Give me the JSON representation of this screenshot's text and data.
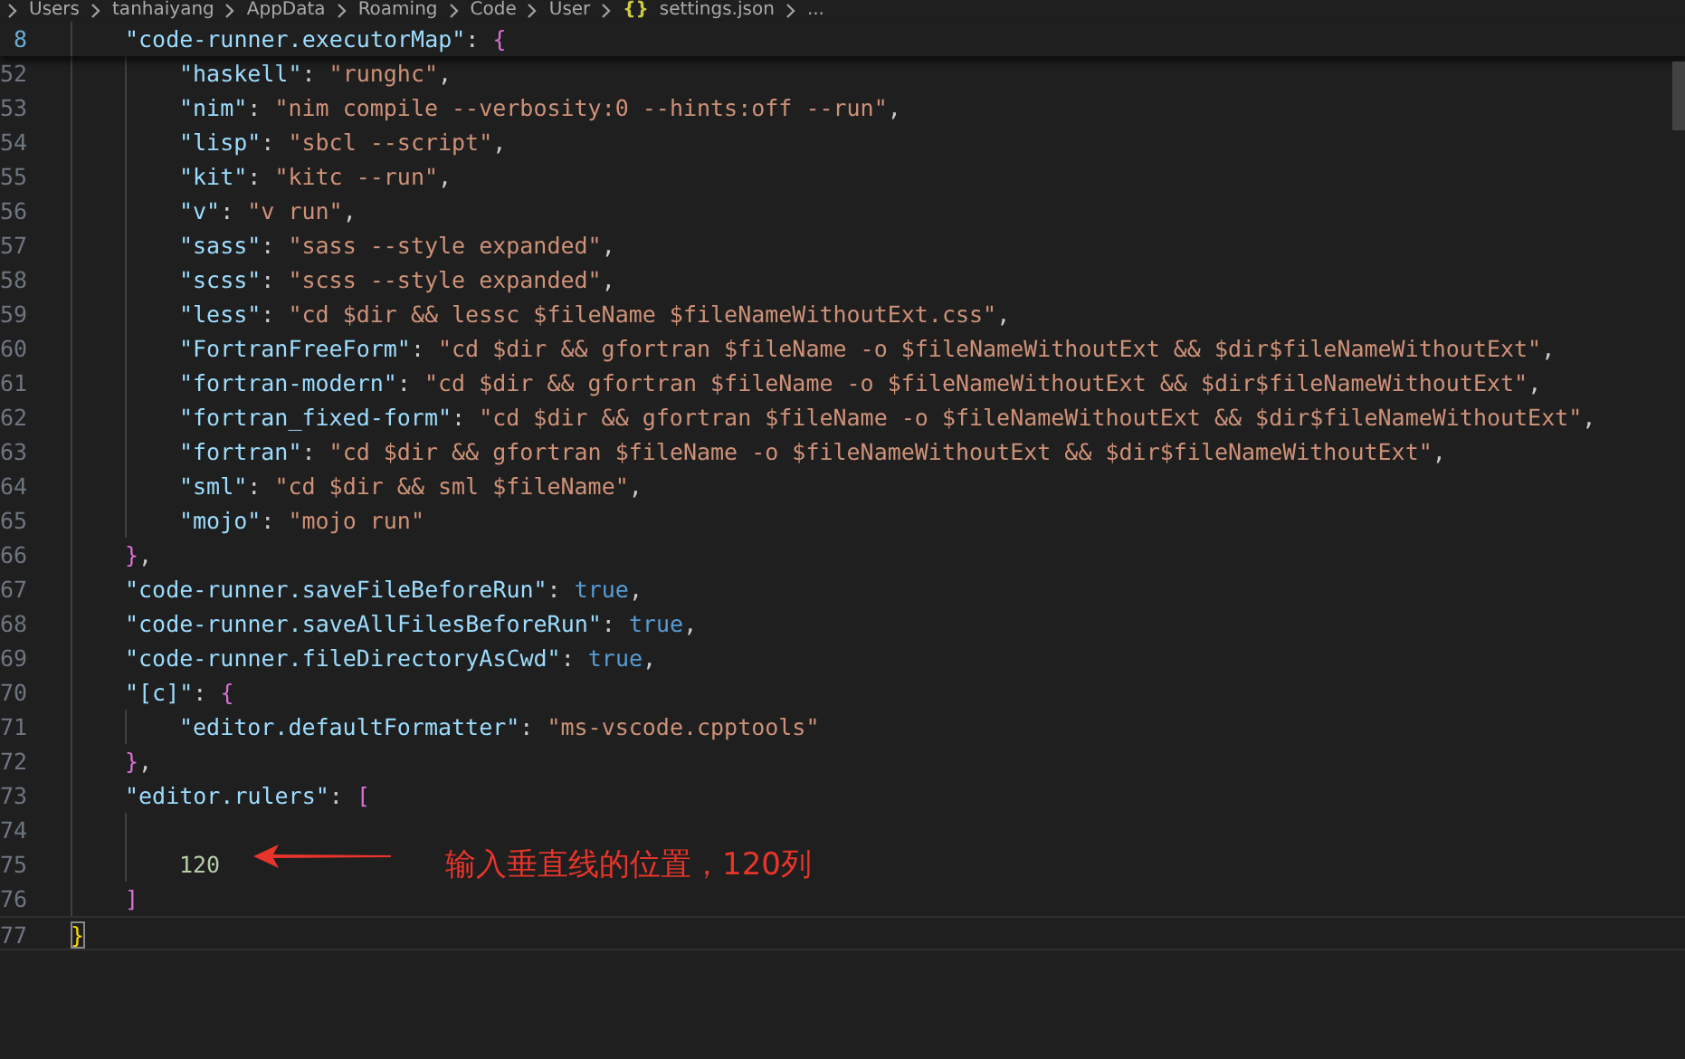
{
  "breadcrumb": [
    {
      "kind": "folder",
      "label": "Users"
    },
    {
      "kind": "folder",
      "label": "tanhaiyang"
    },
    {
      "kind": "folder",
      "label": "AppData"
    },
    {
      "kind": "folder",
      "label": "Roaming"
    },
    {
      "kind": "folder",
      "label": "Code"
    },
    {
      "kind": "folder",
      "label": "User"
    },
    {
      "kind": "file",
      "glyph": "{}",
      "label": "settings.json"
    },
    {
      "kind": "more",
      "label": "..."
    }
  ],
  "sticky_line": {
    "number": "8",
    "tokens": [
      {
        "kind": "key",
        "text": "\"code-runner.executorMap\""
      },
      {
        "kind": "punct",
        "text": ": "
      },
      {
        "kind": "bracket-inner",
        "text": "{"
      }
    ],
    "children": [
      {
        "number": "52",
        "tokens": [
          {
            "kind": "key",
            "text": "\"haskell\""
          },
          {
            "kind": "punct",
            "text": ": "
          },
          {
            "kind": "string",
            "text": "\"runghc\""
          },
          {
            "kind": "punct",
            "text": ","
          }
        ]
      },
      {
        "number": "53",
        "tokens": [
          {
            "kind": "key",
            "text": "\"nim\""
          },
          {
            "kind": "punct",
            "text": ": "
          },
          {
            "kind": "string",
            "text": "\"nim compile --verbosity:0 --hints:off --run\""
          },
          {
            "kind": "punct",
            "text": ","
          }
        ]
      },
      {
        "number": "54",
        "tokens": [
          {
            "kind": "key",
            "text": "\"lisp\""
          },
          {
            "kind": "punct",
            "text": ": "
          },
          {
            "kind": "string",
            "text": "\"sbcl --script\""
          },
          {
            "kind": "punct",
            "text": ","
          }
        ]
      },
      {
        "number": "55",
        "tokens": [
          {
            "kind": "key",
            "text": "\"kit\""
          },
          {
            "kind": "punct",
            "text": ": "
          },
          {
            "kind": "string",
            "text": "\"kitc --run\""
          },
          {
            "kind": "punct",
            "text": ","
          }
        ]
      },
      {
        "number": "56",
        "tokens": [
          {
            "kind": "key",
            "text": "\"v\""
          },
          {
            "kind": "punct",
            "text": ": "
          },
          {
            "kind": "string",
            "text": "\"v run\""
          },
          {
            "kind": "punct",
            "text": ","
          }
        ]
      },
      {
        "number": "57",
        "tokens": [
          {
            "kind": "key",
            "text": "\"sass\""
          },
          {
            "kind": "punct",
            "text": ": "
          },
          {
            "kind": "string",
            "text": "\"sass --style expanded\""
          },
          {
            "kind": "punct",
            "text": ","
          }
        ]
      },
      {
        "number": "58",
        "tokens": [
          {
            "kind": "key",
            "text": "\"scss\""
          },
          {
            "kind": "punct",
            "text": ": "
          },
          {
            "kind": "string",
            "text": "\"scss --style expanded\""
          },
          {
            "kind": "punct",
            "text": ","
          }
        ]
      },
      {
        "number": "59",
        "tokens": [
          {
            "kind": "key",
            "text": "\"less\""
          },
          {
            "kind": "punct",
            "text": ": "
          },
          {
            "kind": "string",
            "text": "\"cd $dir && lessc $fileName $fileNameWithoutExt.css\""
          },
          {
            "kind": "punct",
            "text": ","
          }
        ]
      },
      {
        "number": "60",
        "tokens": [
          {
            "kind": "key",
            "text": "\"FortranFreeForm\""
          },
          {
            "kind": "punct",
            "text": ": "
          },
          {
            "kind": "string",
            "text": "\"cd $dir && gfortran $fileName -o $fileNameWithoutExt && $dir$fileNameWithoutExt\""
          },
          {
            "kind": "punct",
            "text": ","
          }
        ]
      },
      {
        "number": "61",
        "tokens": [
          {
            "kind": "key",
            "text": "\"fortran-modern\""
          },
          {
            "kind": "punct",
            "text": ": "
          },
          {
            "kind": "string",
            "text": "\"cd $dir && gfortran $fileName -o $fileNameWithoutExt && $dir$fileNameWithoutExt\""
          },
          {
            "kind": "punct",
            "text": ","
          }
        ]
      },
      {
        "number": "62",
        "tokens": [
          {
            "kind": "key",
            "text": "\"fortran_fixed-form\""
          },
          {
            "kind": "punct",
            "text": ": "
          },
          {
            "kind": "string",
            "text": "\"cd $dir && gfortran $fileName -o $fileNameWithoutExt && $dir$fileNameWithoutExt\""
          },
          {
            "kind": "punct",
            "text": ","
          }
        ]
      },
      {
        "number": "63",
        "tokens": [
          {
            "kind": "key",
            "text": "\"fortran\""
          },
          {
            "kind": "punct",
            "text": ": "
          },
          {
            "kind": "string",
            "text": "\"cd $dir && gfortran $fileName -o $fileNameWithoutExt && $dir$fileNameWithoutExt\""
          },
          {
            "kind": "punct",
            "text": ","
          }
        ]
      },
      {
        "number": "64",
        "tokens": [
          {
            "kind": "key",
            "text": "\"sml\""
          },
          {
            "kind": "punct",
            "text": ": "
          },
          {
            "kind": "string",
            "text": "\"cd $dir && sml $fileName\""
          },
          {
            "kind": "punct",
            "text": ","
          }
        ]
      },
      {
        "number": "65",
        "tokens": [
          {
            "kind": "key",
            "text": "\"mojo\""
          },
          {
            "kind": "punct",
            "text": ": "
          },
          {
            "kind": "string",
            "text": "\"mojo run\""
          }
        ]
      }
    ]
  },
  "lines": [
    {
      "number": "66",
      "tokens": [
        {
          "kind": "bracket-inner",
          "text": "}"
        },
        {
          "kind": "punct",
          "text": ","
        }
      ]
    },
    {
      "number": "67",
      "tokens": [
        {
          "kind": "key",
          "text": "\"code-runner.saveFileBeforeRun\""
        },
        {
          "kind": "punct",
          "text": ": "
        },
        {
          "kind": "bool",
          "text": "true"
        },
        {
          "kind": "punct",
          "text": ","
        }
      ]
    },
    {
      "number": "68",
      "tokens": [
        {
          "kind": "key",
          "text": "\"code-runner.saveAllFilesBeforeRun\""
        },
        {
          "kind": "punct",
          "text": ": "
        },
        {
          "kind": "bool",
          "text": "true"
        },
        {
          "kind": "punct",
          "text": ","
        }
      ]
    },
    {
      "number": "69",
      "tokens": [
        {
          "kind": "key",
          "text": "\"code-runner.fileDirectoryAsCwd\""
        },
        {
          "kind": "punct",
          "text": ": "
        },
        {
          "kind": "bool",
          "text": "true"
        },
        {
          "kind": "punct",
          "text": ","
        }
      ]
    },
    {
      "number": "70",
      "tokens": [
        {
          "kind": "key",
          "text": "\"[c]\""
        },
        {
          "kind": "punct",
          "text": ": "
        },
        {
          "kind": "bracket-inner",
          "text": "{"
        }
      ],
      "children": [
        {
          "number": "71",
          "tokens": [
            {
              "kind": "key",
              "text": "\"editor.defaultFormatter\""
            },
            {
              "kind": "punct",
              "text": ": "
            },
            {
              "kind": "string",
              "text": "\"ms-vscode.cpptools\""
            }
          ]
        }
      ]
    },
    {
      "number": "72",
      "tokens": [
        {
          "kind": "bracket-inner",
          "text": "}"
        },
        {
          "kind": "punct",
          "text": ","
        }
      ]
    },
    {
      "number": "73",
      "tokens": [
        {
          "kind": "key",
          "text": "\"editor.rulers\""
        },
        {
          "kind": "punct",
          "text": ": "
        },
        {
          "kind": "bracket-inner",
          "text": "["
        }
      ],
      "children": [
        {
          "number": "74"
        },
        {
          "number": "75",
          "tokens": [
            {
              "kind": "number",
              "text": "120"
            }
          ]
        }
      ]
    },
    {
      "number": "76",
      "tokens": [
        {
          "kind": "bracket-inner",
          "text": "]"
        }
      ]
    }
  ],
  "closing_line": {
    "number": "77",
    "current": true,
    "tokens": [
      {
        "kind": "bracket-outer-matched",
        "text": "}"
      }
    ]
  },
  "annotation": {
    "text": "输入垂直线的位置，120列"
  }
}
